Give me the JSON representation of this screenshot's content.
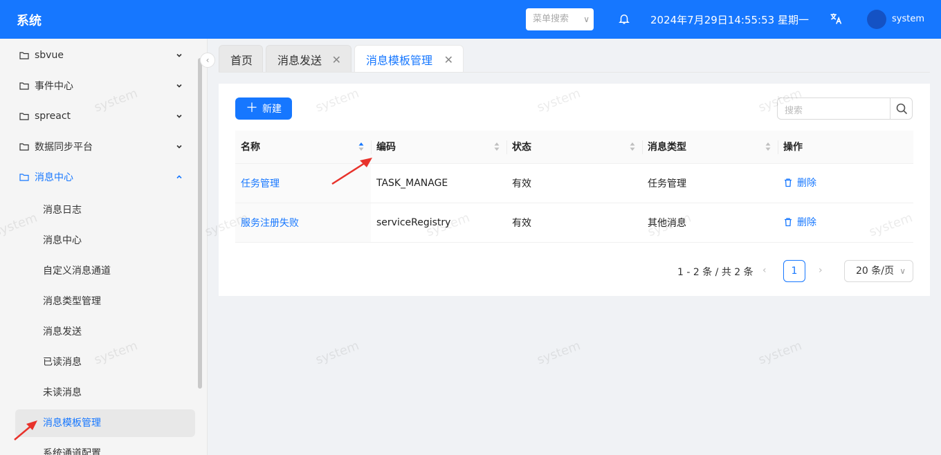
{
  "header": {
    "title": "系统",
    "menu_search_placeholder": "菜单搜索",
    "datetime": "2024年7月29日14:55:53 星期一",
    "username": "system"
  },
  "sidebar": {
    "groups": [
      {
        "label": "sbvue"
      },
      {
        "label": "事件中心"
      },
      {
        "label": "spreact"
      },
      {
        "label": "数据同步平台"
      },
      {
        "label": "消息中心"
      }
    ],
    "sub_items": [
      {
        "label": "消息日志"
      },
      {
        "label": "消息中心"
      },
      {
        "label": "自定义消息通道"
      },
      {
        "label": "消息类型管理"
      },
      {
        "label": "消息发送"
      },
      {
        "label": "已读消息"
      },
      {
        "label": "未读消息"
      },
      {
        "label": "消息模板管理"
      },
      {
        "label": "系统通道配置"
      }
    ]
  },
  "tabs": [
    {
      "label": "首页"
    },
    {
      "label": "消息发送"
    },
    {
      "label": "消息模板管理"
    }
  ],
  "toolbar": {
    "new_label": "新建",
    "search_placeholder": "搜索"
  },
  "table": {
    "headers": [
      "名称",
      "编码",
      "状态",
      "消息类型",
      "操作"
    ],
    "rows": [
      {
        "name": "任务管理",
        "code": "TASK_MANAGE",
        "status": "有效",
        "type": "任务管理",
        "action": "删除"
      },
      {
        "name": "服务注册失败",
        "code": "serviceRegistry",
        "status": "有效",
        "type": "其他消息",
        "action": "删除"
      }
    ]
  },
  "pagination": {
    "total_text": "1 - 2 条 / 共 2 条",
    "current_page": "1",
    "page_size": "20 条/页"
  },
  "watermark": "system",
  "colors": {
    "primary": "#1677ff",
    "arrow": "#e8322b"
  }
}
